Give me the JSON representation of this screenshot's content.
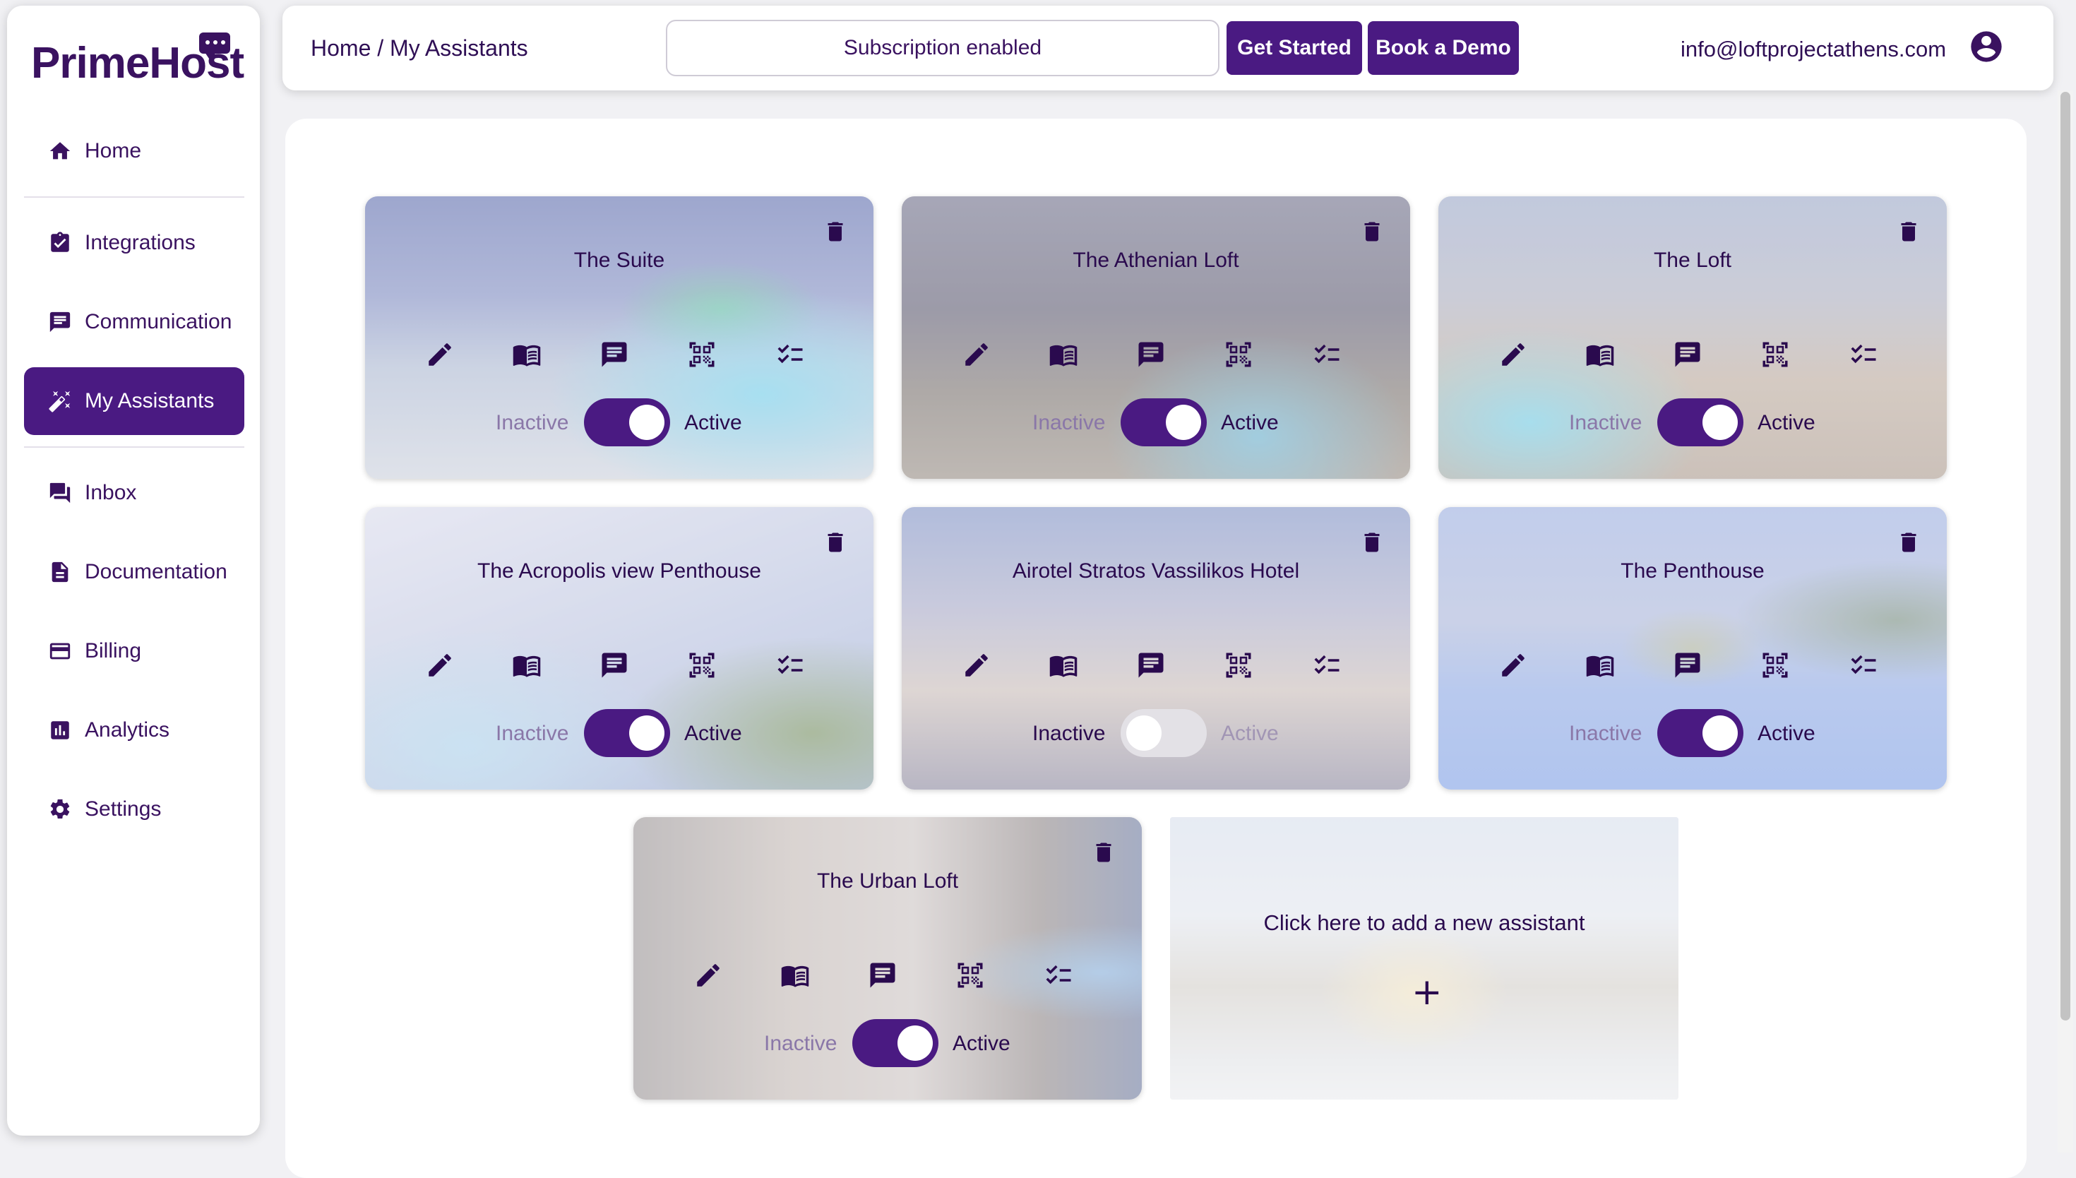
{
  "app": {
    "logo": "PrimeHost"
  },
  "sidebar": {
    "items": [
      {
        "label": "Home",
        "icon": "home-icon"
      },
      {
        "label": "Integrations",
        "icon": "integrations-icon"
      },
      {
        "label": "Communication",
        "icon": "chat-icon"
      },
      {
        "label": "My Assistants",
        "icon": "magic-wand-icon",
        "active": true
      },
      {
        "label": "Inbox",
        "icon": "inbox-icon"
      },
      {
        "label": "Documentation",
        "icon": "document-icon"
      },
      {
        "label": "Billing",
        "icon": "credit-card-icon"
      },
      {
        "label": "Analytics",
        "icon": "analytics-icon"
      },
      {
        "label": "Settings",
        "icon": "gear-icon"
      }
    ]
  },
  "header": {
    "breadcrumb": "Home / My Assistants",
    "subscription_status": "Subscription enabled",
    "get_started": "Get Started",
    "book_demo": "Book a Demo",
    "user_email": "info@loftprojectathens.com"
  },
  "toggle_labels": {
    "inactive": "Inactive",
    "active": "Active"
  },
  "assistants": [
    {
      "name": "The Suite",
      "active": true
    },
    {
      "name": "The Athenian Loft",
      "active": true
    },
    {
      "name": "The Loft",
      "active": true
    },
    {
      "name": "The Acropolis view Penthouse",
      "active": true
    },
    {
      "name": "Airotel Stratos Vassilikos Hotel",
      "active": false
    },
    {
      "name": "The Penthouse",
      "active": true
    },
    {
      "name": "The Urban Loft",
      "active": true
    }
  ],
  "add_assistant": {
    "label": "Click here to add a new assistant",
    "plus": "+"
  },
  "colors": {
    "accent": "#4a1a82",
    "text": "#2a0a4e"
  }
}
